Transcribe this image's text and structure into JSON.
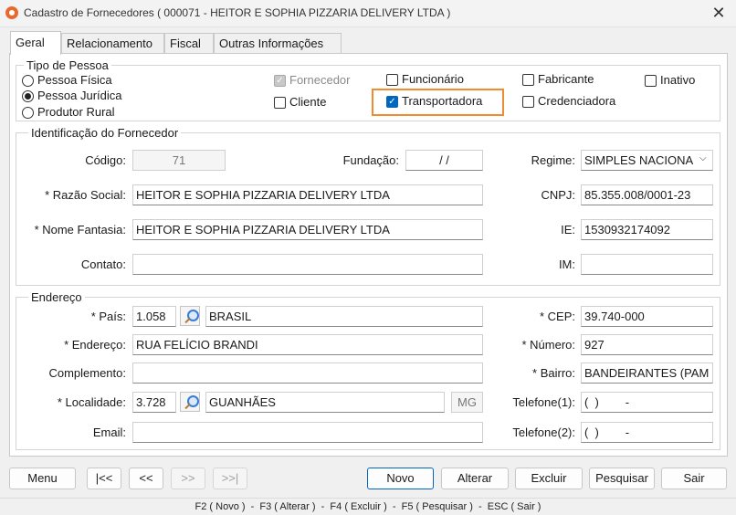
{
  "window": {
    "title": "Cadastro de Fornecedores ( 000071 - HEITOR E SOPHIA PIZZARIA DELIVERY LTDA )",
    "close_glyph": "✕"
  },
  "tabs": [
    {
      "label": "Geral"
    },
    {
      "label": "Relacionamento"
    },
    {
      "label": "Fiscal"
    },
    {
      "label": "Outras Informações"
    }
  ],
  "tipo_pessoa": {
    "legend": "Tipo de Pessoa",
    "options": [
      {
        "label": "Pessoa Física",
        "selected": false
      },
      {
        "label": "Pessoa Jurídica",
        "selected": true
      },
      {
        "label": "Produtor Rural",
        "selected": false
      }
    ]
  },
  "checks": {
    "fornecedor": {
      "label": "Fornecedor",
      "checked": true,
      "disabled": true
    },
    "cliente": {
      "label": "Cliente",
      "checked": false
    },
    "funcionario": {
      "label": "Funcionário",
      "checked": false
    },
    "transportadora": {
      "label": "Transportadora",
      "checked": true
    },
    "fabricante": {
      "label": "Fabricante",
      "checked": false
    },
    "credenciadora": {
      "label": "Credenciadora",
      "checked": false
    },
    "inativo": {
      "label": "Inativo",
      "checked": false
    }
  },
  "identificacao": {
    "legend": "Identificação do Fornecedor",
    "codigo_label": "Código:",
    "codigo": "71",
    "fundacao_label": "Fundação:",
    "fundacao": " /  /",
    "regime_label": "Regime:",
    "regime": "SIMPLES NACIONA",
    "razao_label": "* Razão Social:",
    "razao": "HEITOR E SOPHIA PIZZARIA DELIVERY LTDA",
    "cnpj_label": "CNPJ:",
    "cnpj": "85.355.008/0001-23",
    "fantasia_label": "* Nome Fantasia:",
    "fantasia": "HEITOR E SOPHIA PIZZARIA DELIVERY LTDA",
    "ie_label": "IE:",
    "ie": "1530932174092",
    "contato_label": "Contato:",
    "contato": "",
    "im_label": "IM:",
    "im": ""
  },
  "endereco": {
    "legend": "Endereço",
    "pais_label": "* País:",
    "pais_codigo": "1.058",
    "pais_nome": "BRASIL",
    "cep_label": "* CEP:",
    "cep": "39.740-000",
    "endereco_label": "* Endereço:",
    "endereco": "RUA FELÍCIO BRANDI",
    "numero_label": "* Número:",
    "numero": "927",
    "complemento_label": "Complemento:",
    "complemento": "",
    "bairro_label": "* Bairro:",
    "bairro": "BANDEIRANTES (PAM",
    "localidade_label": "* Localidade:",
    "localidade_codigo": "3.728",
    "localidade_nome": "GUANHÃES",
    "uf": "MG",
    "telefone1_label": "Telefone(1):",
    "telefone1": "(  )        -",
    "email_label": "Email:",
    "email": "",
    "telefone2_label": "Telefone(2):",
    "telefone2": "(  )        -"
  },
  "buttons": {
    "menu": "Menu",
    "first": "|<<",
    "prev": "<<",
    "next": ">>",
    "last": ">>|",
    "novo": "Novo",
    "alterar": "Alterar",
    "excluir": "Excluir",
    "pesquisar": "Pesquisar",
    "sair": "Sair"
  },
  "statusbar": "F2 ( Novo )  -  F3 ( Alterar )  -  F4 ( Excluir )  -  F5 ( Pesquisar )  -  ESC ( Sair )",
  "icons": {
    "check": "✓",
    "dropdown": "⌵"
  },
  "colors": {
    "highlight": "#f28a2e",
    "accent": "#0067c0",
    "app_icon": "#e8692e"
  }
}
